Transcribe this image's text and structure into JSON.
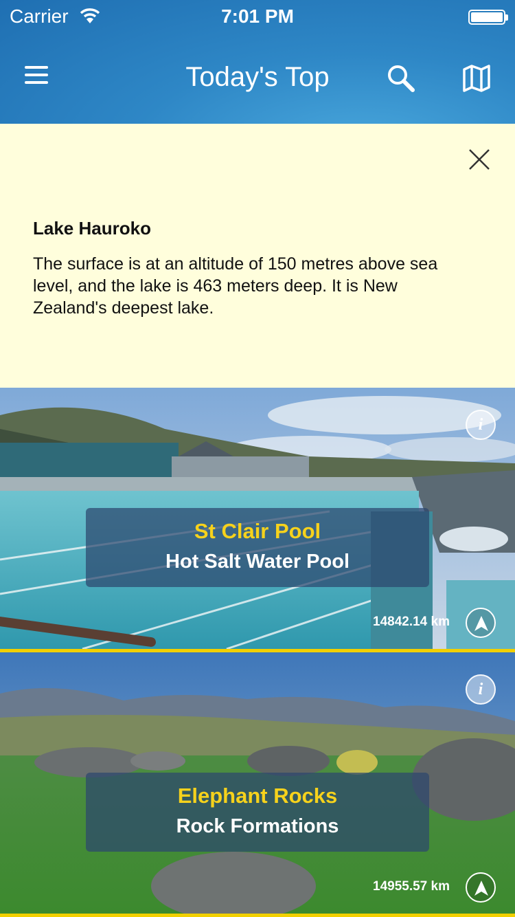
{
  "status": {
    "carrier": "Carrier",
    "time": "7:01 PM"
  },
  "nav": {
    "title": "Today's Top"
  },
  "info_panel": {
    "heading": "Lake Hauroko",
    "body": "The surface is at an altitude of 150 metres above sea level, and the lake is 463 meters deep. It is New Zealand's deepest lake."
  },
  "places": [
    {
      "name": "St Clair Pool",
      "subtitle": "Hot Salt Water Pool",
      "distance": "14842.14 km"
    },
    {
      "name": "Elephant Rocks",
      "subtitle": "Rock Formations",
      "distance": "14955.57 km"
    }
  ],
  "colors": {
    "accent": "#f2d000",
    "nav_blue": "#2e87c6",
    "info_bg": "#fffedc"
  },
  "icons": {
    "menu": "menu-icon",
    "search": "search-icon",
    "map": "map-icon",
    "close": "close-icon",
    "info": "info-icon",
    "navigate": "navigation-arrow-icon"
  }
}
